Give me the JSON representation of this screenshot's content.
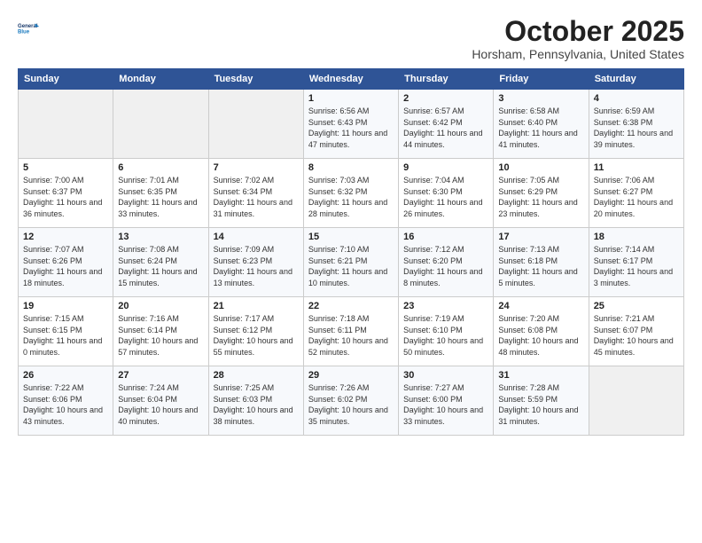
{
  "header": {
    "logo_line1": "General",
    "logo_line2": "Blue",
    "month": "October 2025",
    "location": "Horsham, Pennsylvania, United States"
  },
  "weekdays": [
    "Sunday",
    "Monday",
    "Tuesday",
    "Wednesday",
    "Thursday",
    "Friday",
    "Saturday"
  ],
  "weeks": [
    [
      {
        "day": "",
        "info": ""
      },
      {
        "day": "",
        "info": ""
      },
      {
        "day": "",
        "info": ""
      },
      {
        "day": "1",
        "info": "Sunrise: 6:56 AM\nSunset: 6:43 PM\nDaylight: 11 hours and 47 minutes."
      },
      {
        "day": "2",
        "info": "Sunrise: 6:57 AM\nSunset: 6:42 PM\nDaylight: 11 hours and 44 minutes."
      },
      {
        "day": "3",
        "info": "Sunrise: 6:58 AM\nSunset: 6:40 PM\nDaylight: 11 hours and 41 minutes."
      },
      {
        "day": "4",
        "info": "Sunrise: 6:59 AM\nSunset: 6:38 PM\nDaylight: 11 hours and 39 minutes."
      }
    ],
    [
      {
        "day": "5",
        "info": "Sunrise: 7:00 AM\nSunset: 6:37 PM\nDaylight: 11 hours and 36 minutes."
      },
      {
        "day": "6",
        "info": "Sunrise: 7:01 AM\nSunset: 6:35 PM\nDaylight: 11 hours and 33 minutes."
      },
      {
        "day": "7",
        "info": "Sunrise: 7:02 AM\nSunset: 6:34 PM\nDaylight: 11 hours and 31 minutes."
      },
      {
        "day": "8",
        "info": "Sunrise: 7:03 AM\nSunset: 6:32 PM\nDaylight: 11 hours and 28 minutes."
      },
      {
        "day": "9",
        "info": "Sunrise: 7:04 AM\nSunset: 6:30 PM\nDaylight: 11 hours and 26 minutes."
      },
      {
        "day": "10",
        "info": "Sunrise: 7:05 AM\nSunset: 6:29 PM\nDaylight: 11 hours and 23 minutes."
      },
      {
        "day": "11",
        "info": "Sunrise: 7:06 AM\nSunset: 6:27 PM\nDaylight: 11 hours and 20 minutes."
      }
    ],
    [
      {
        "day": "12",
        "info": "Sunrise: 7:07 AM\nSunset: 6:26 PM\nDaylight: 11 hours and 18 minutes."
      },
      {
        "day": "13",
        "info": "Sunrise: 7:08 AM\nSunset: 6:24 PM\nDaylight: 11 hours and 15 minutes."
      },
      {
        "day": "14",
        "info": "Sunrise: 7:09 AM\nSunset: 6:23 PM\nDaylight: 11 hours and 13 minutes."
      },
      {
        "day": "15",
        "info": "Sunrise: 7:10 AM\nSunset: 6:21 PM\nDaylight: 11 hours and 10 minutes."
      },
      {
        "day": "16",
        "info": "Sunrise: 7:12 AM\nSunset: 6:20 PM\nDaylight: 11 hours and 8 minutes."
      },
      {
        "day": "17",
        "info": "Sunrise: 7:13 AM\nSunset: 6:18 PM\nDaylight: 11 hours and 5 minutes."
      },
      {
        "day": "18",
        "info": "Sunrise: 7:14 AM\nSunset: 6:17 PM\nDaylight: 11 hours and 3 minutes."
      }
    ],
    [
      {
        "day": "19",
        "info": "Sunrise: 7:15 AM\nSunset: 6:15 PM\nDaylight: 11 hours and 0 minutes."
      },
      {
        "day": "20",
        "info": "Sunrise: 7:16 AM\nSunset: 6:14 PM\nDaylight: 10 hours and 57 minutes."
      },
      {
        "day": "21",
        "info": "Sunrise: 7:17 AM\nSunset: 6:12 PM\nDaylight: 10 hours and 55 minutes."
      },
      {
        "day": "22",
        "info": "Sunrise: 7:18 AM\nSunset: 6:11 PM\nDaylight: 10 hours and 52 minutes."
      },
      {
        "day": "23",
        "info": "Sunrise: 7:19 AM\nSunset: 6:10 PM\nDaylight: 10 hours and 50 minutes."
      },
      {
        "day": "24",
        "info": "Sunrise: 7:20 AM\nSunset: 6:08 PM\nDaylight: 10 hours and 48 minutes."
      },
      {
        "day": "25",
        "info": "Sunrise: 7:21 AM\nSunset: 6:07 PM\nDaylight: 10 hours and 45 minutes."
      }
    ],
    [
      {
        "day": "26",
        "info": "Sunrise: 7:22 AM\nSunset: 6:06 PM\nDaylight: 10 hours and 43 minutes."
      },
      {
        "day": "27",
        "info": "Sunrise: 7:24 AM\nSunset: 6:04 PM\nDaylight: 10 hours and 40 minutes."
      },
      {
        "day": "28",
        "info": "Sunrise: 7:25 AM\nSunset: 6:03 PM\nDaylight: 10 hours and 38 minutes."
      },
      {
        "day": "29",
        "info": "Sunrise: 7:26 AM\nSunset: 6:02 PM\nDaylight: 10 hours and 35 minutes."
      },
      {
        "day": "30",
        "info": "Sunrise: 7:27 AM\nSunset: 6:00 PM\nDaylight: 10 hours and 33 minutes."
      },
      {
        "day": "31",
        "info": "Sunrise: 7:28 AM\nSunset: 5:59 PM\nDaylight: 10 hours and 31 minutes."
      },
      {
        "day": "",
        "info": ""
      }
    ]
  ]
}
